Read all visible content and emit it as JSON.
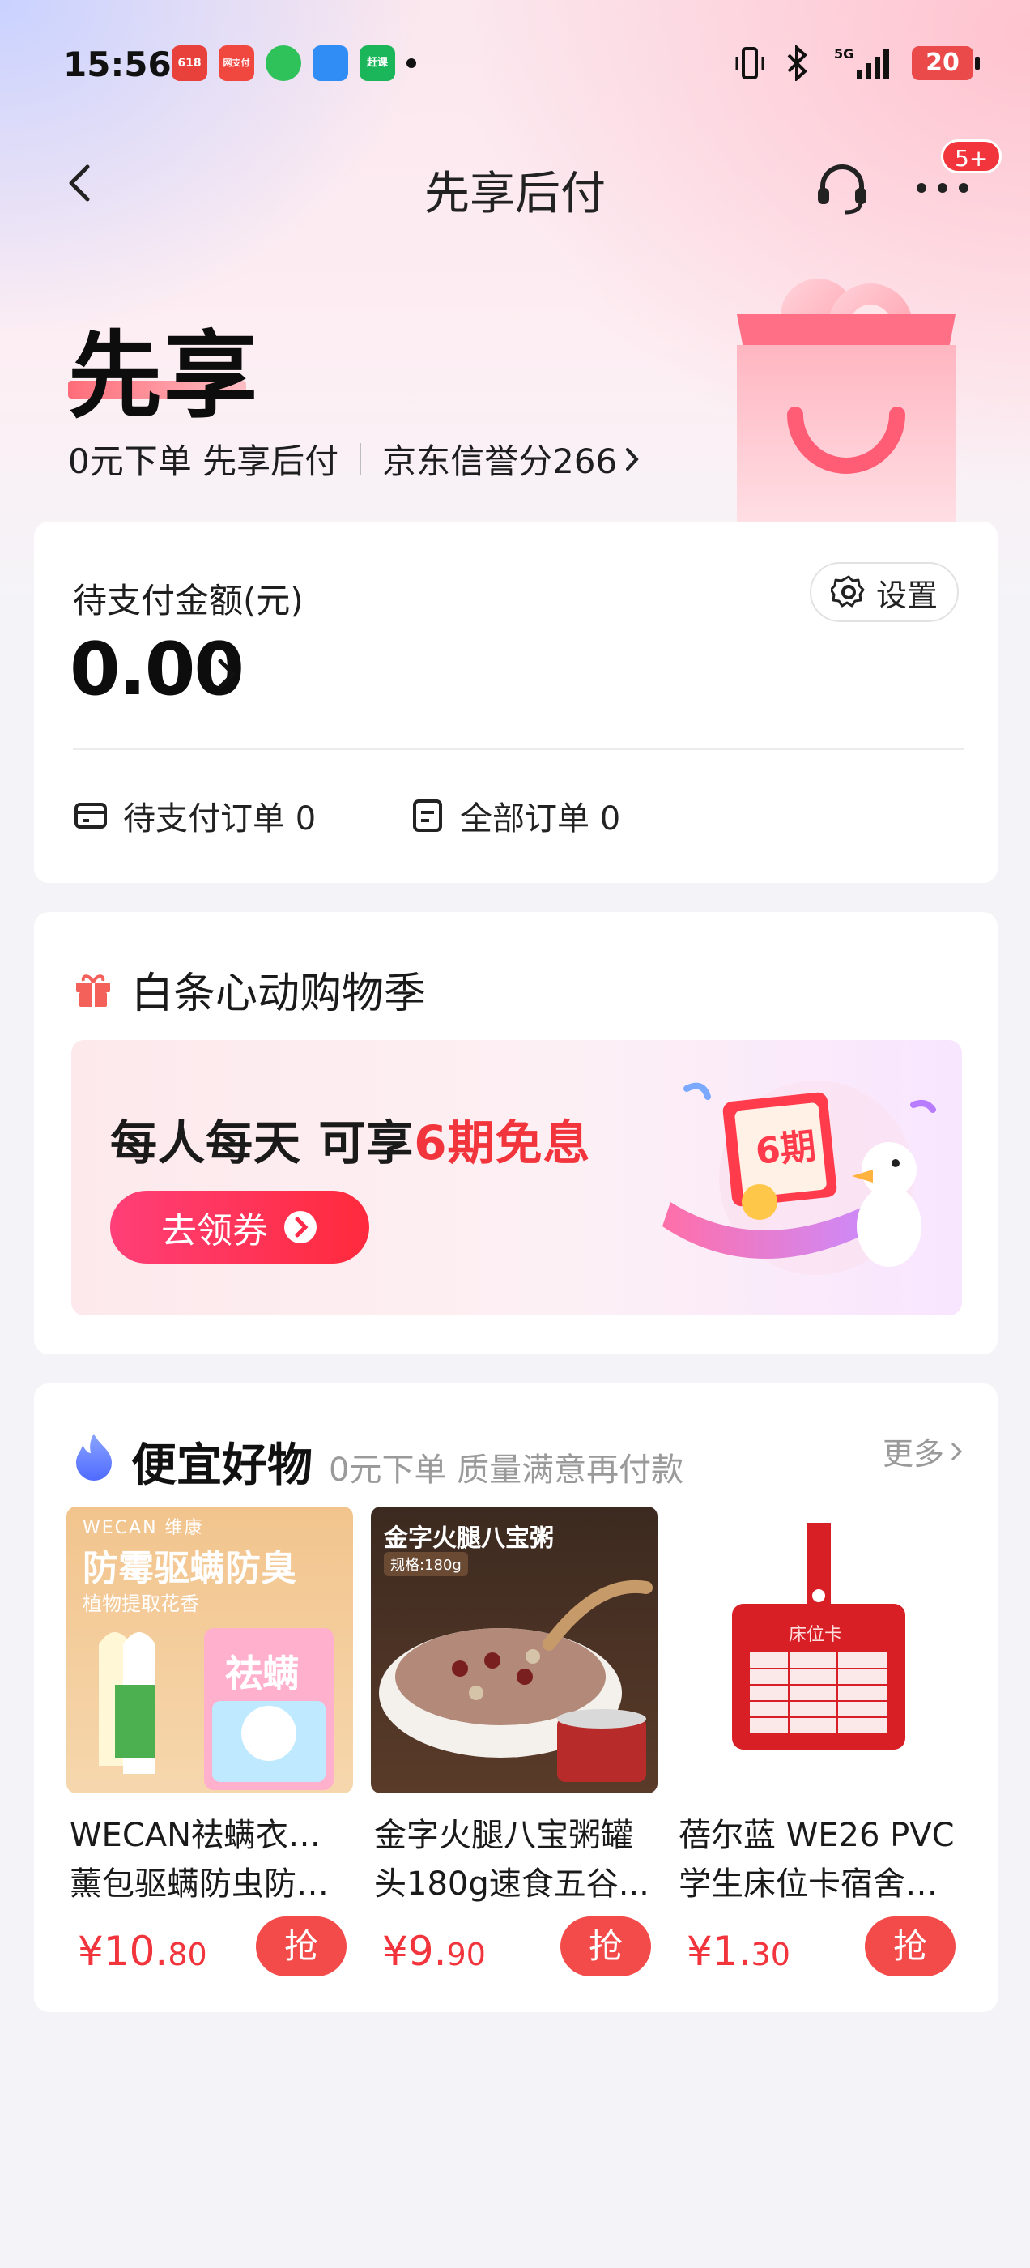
{
  "status_bar": {
    "time": "15:56",
    "battery": "20",
    "notification_icons": [
      "618",
      "网支付",
      "chat",
      "feather",
      "赶课"
    ]
  },
  "nav": {
    "title": "先享后付",
    "more_badge": "5+"
  },
  "hero": {
    "title": "先享",
    "subtitle": "0元下单 先享后付",
    "credit_link": "京东信誉分266"
  },
  "payment": {
    "label": "待支付金额(元)",
    "amount": "0.00",
    "settings_label": "设置",
    "pending_orders": "待支付订单 0",
    "all_orders": "全部订单 0"
  },
  "promo": {
    "title": "白条心动购物季",
    "banner_prefix": "每人每天 可享",
    "banner_highlight": "6期免息",
    "button_label": "去领券",
    "art_label": "6期"
  },
  "deals": {
    "title": "便宜好物",
    "subtitle": "0元下单 质量满意再付款",
    "more_label": "更多",
    "products": [
      {
        "line1": "WECAN祛螨衣柜香",
        "line2": "薰包驱螨防虫防霉...",
        "price_int": "¥10.",
        "price_dec": "80",
        "grab": "抢",
        "img_brand": "WECAN 维康",
        "img_headline": "防霉驱螨防臭",
        "img_sub": "植物提取花香",
        "img_pack": "祛螨"
      },
      {
        "line1": "金字火腿八宝粥罐",
        "line2": "头180g速食五谷...",
        "price_int": "¥9.",
        "price_dec": "90",
        "grab": "抢",
        "img_headline": "金字火腿八宝粥",
        "img_sub": "规格:180g"
      },
      {
        "line1": "蓓尔蓝 WE26 PVC",
        "line2": "学生床位卡宿舍床...",
        "price_int": "¥1.",
        "price_dec": "30",
        "grab": "抢",
        "img_card": "床位卡"
      }
    ]
  },
  "colors": {
    "accent": "#f2353c",
    "grab_button": "#f34a4a",
    "muted_text": "#9a9a9a"
  }
}
